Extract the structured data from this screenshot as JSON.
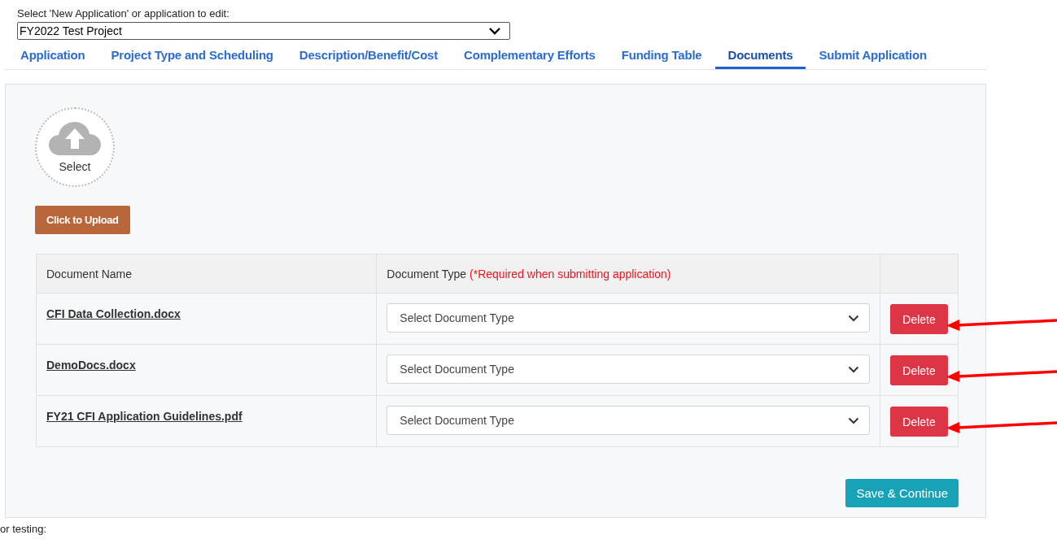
{
  "application_picker": {
    "label": "Select 'New Application' or application to edit:",
    "value": "FY2022 Test Project"
  },
  "tabs": [
    {
      "label": "Application",
      "selected": false
    },
    {
      "label": "Project Type and Scheduling",
      "selected": false
    },
    {
      "label": "Description/Benefit/Cost",
      "selected": false
    },
    {
      "label": "Complementary Efforts",
      "selected": false
    },
    {
      "label": "Funding Table",
      "selected": false
    },
    {
      "label": "Documents",
      "selected": true
    },
    {
      "label": "Submit Application",
      "selected": false
    }
  ],
  "upload": {
    "select_label": "Select",
    "button": "Click to Upload"
  },
  "table": {
    "columns": [
      {
        "label": "Document Name"
      },
      {
        "label": "Document Type",
        "note": "(*Required when submitting application)"
      }
    ],
    "rows": [
      {
        "name": "CFI Data Collection.docx",
        "type_placeholder": "Select Document Type",
        "action": "Delete",
        "arrow": true
      },
      {
        "name": "DemoDocs.docx",
        "type_placeholder": "Select Document Type",
        "action": "Delete",
        "arrow": true
      },
      {
        "name": "FY21 CFI Application Guidelines.pdf",
        "type_placeholder": "Select Document Type",
        "action": "Delete",
        "arrow": true
      }
    ]
  },
  "save_button": "Save & Continue",
  "footer_text": "or testing:"
}
